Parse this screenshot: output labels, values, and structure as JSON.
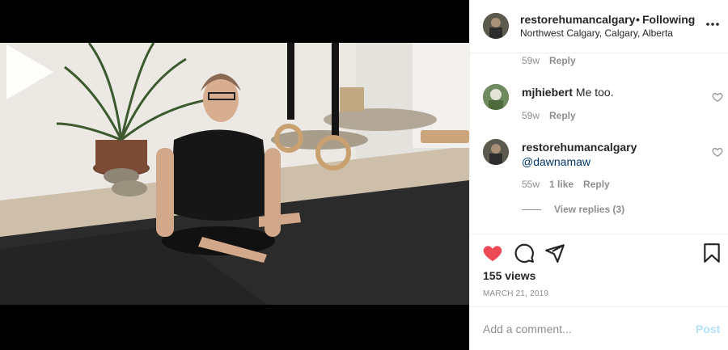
{
  "post": {
    "username": "restorehumancalgary",
    "separator": "•",
    "follow_label": "Following",
    "location": "Northwest Calgary, Calgary, Alberta"
  },
  "comments": [
    {
      "meta_time": "59w",
      "reply_label": "Reply"
    },
    {
      "username": "mjhiebert",
      "text": "Me too.",
      "meta_time": "59w",
      "reply_label": "Reply"
    },
    {
      "username": "restorehumancalgary",
      "mention": "@dawnamaw",
      "meta_time": "55w",
      "likes": "1 like",
      "reply_label": "Reply",
      "view_replies": "View replies (3)"
    }
  ],
  "actions": {
    "like_icon": "heart-filled",
    "comment_icon": "speech-bubble",
    "share_icon": "paper-plane",
    "save_icon": "bookmark"
  },
  "stats": {
    "views": "155 views",
    "date": "March 21, 2019"
  },
  "composer": {
    "placeholder": "Add a comment...",
    "post_label": "Post"
  },
  "colors": {
    "like_red": "#ed4956",
    "mention_blue": "#00376b",
    "post_disabled": "#b2dffc",
    "meta_gray": "#8e8e8e"
  }
}
